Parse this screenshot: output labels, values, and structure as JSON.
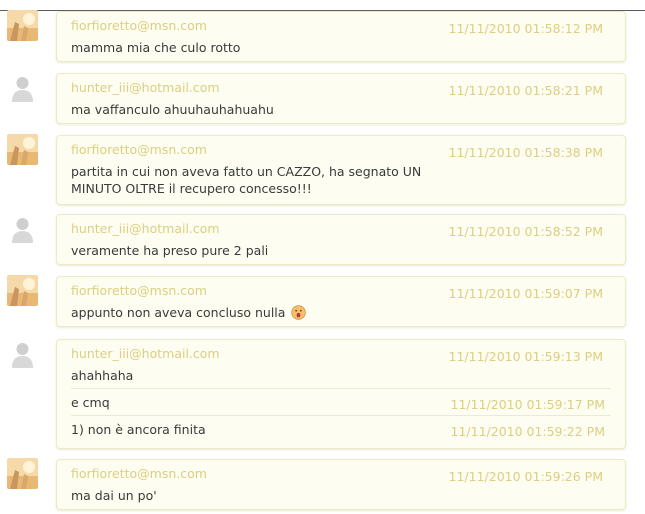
{
  "messages": [
    {
      "sender": "fiorfioretto@msn.com",
      "time": "11/11/2010 01:58:12 PM",
      "text": "mamma mia che culo rotto"
    },
    {
      "sender": "hunter_iii@hotmail.com",
      "time": "11/11/2010 01:58:21 PM",
      "text": "ma vaffanculo ahuuhauhahuahu"
    },
    {
      "sender": "fiorfioretto@msn.com",
      "time": "11/11/2010 01:58:38 PM",
      "text_line1": "partita in cui non aveva fatto un CAZZO, ha segnato UN",
      "text_line2": "MINUTO OLTRE il recupero concesso!!!"
    },
    {
      "sender": "hunter_iii@hotmail.com",
      "time": "11/11/2010 01:58:52 PM",
      "text": "veramente ha preso pure 2 pali"
    },
    {
      "sender": "fiorfioretto@msn.com",
      "time": "11/11/2010 01:59:07 PM",
      "text": "appunto non aveva concluso nulla",
      "emoji": "surprised-face-icon"
    },
    {
      "sender": "hunter_iii@hotmail.com",
      "time": "11/11/2010 01:59:13 PM",
      "text": "ahahhaha",
      "followups": [
        {
          "time": "11/11/2010 01:59:17 PM",
          "text": "e cmq"
        },
        {
          "time": "11/11/2010 01:59:22 PM",
          "text": "1) non è ancora finita"
        }
      ]
    },
    {
      "sender": "fiorfioretto@msn.com",
      "time": "11/11/2010 01:59:26 PM",
      "text": "ma dai un po'"
    }
  ],
  "colors": {
    "sender": "#dccf82",
    "bubble_bg": "#fdfdf1",
    "bubble_border": "#ecebc6"
  },
  "avatars": {
    "fiorfioretto": "photo-avatar",
    "hunter": "default-person-icon"
  }
}
